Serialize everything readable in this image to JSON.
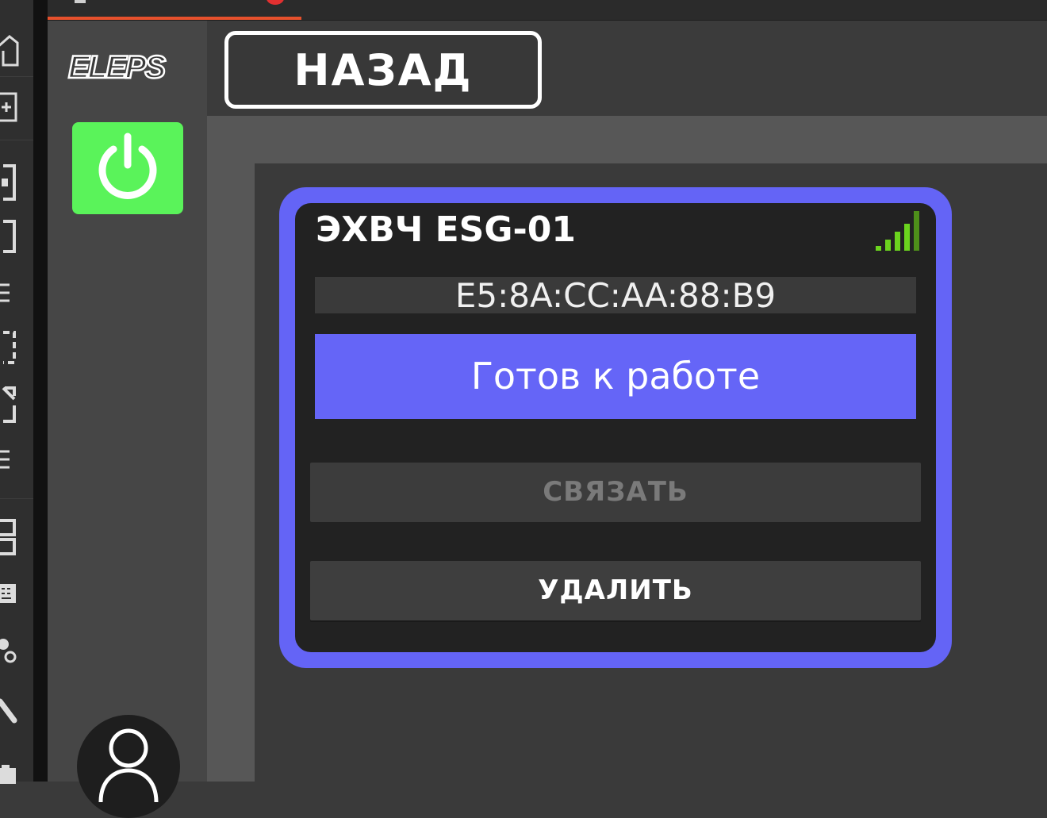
{
  "app": {
    "logo_text": "ELEPS",
    "colors": {
      "accent": "#6464f6",
      "power": "#5af35a",
      "tab_underline": "#e6502c",
      "signal": "#6bd41e"
    }
  },
  "os_toolbar": {
    "icons": [
      "home-icon",
      "add-icon",
      "bracket-icon",
      "bracket-icon",
      "list-icon",
      "bracket-icon",
      "expand-icon",
      "list-icon",
      "copy-icon",
      "keyboard-icon",
      "settings-icon",
      "wrench-icon",
      "camera-icon"
    ]
  },
  "header": {
    "back_label": "НАЗАД"
  },
  "sidebar": {
    "power_icon": "power-icon",
    "avatar_icon": "user-icon"
  },
  "device_card": {
    "name": "ЭХВЧ ESG-01",
    "mac": "E5:8A:CC:AA:88:B9",
    "status": "Готов к работе",
    "link_label": "СВЯЗАТЬ",
    "link_enabled": false,
    "delete_label": "УДАЛИТЬ",
    "signal_bars": 5,
    "signal_level": 5
  }
}
